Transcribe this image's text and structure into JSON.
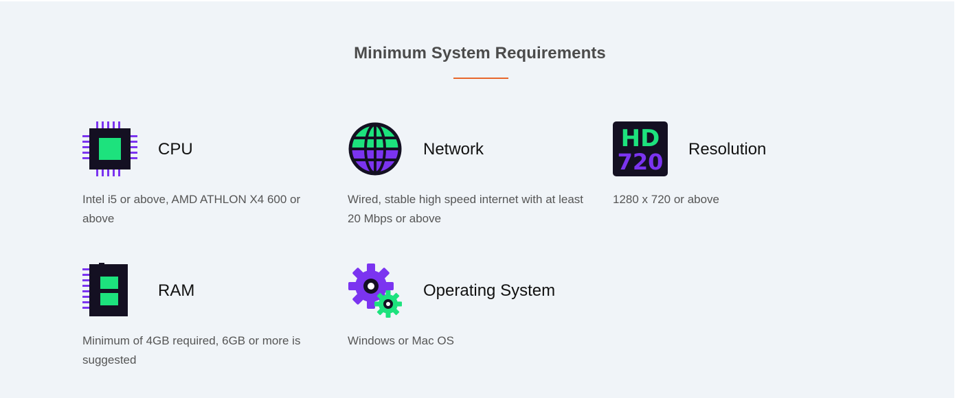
{
  "section": {
    "title": "Minimum System Requirements"
  },
  "colors": {
    "background": "#f0f4f8",
    "accent_underline": "#e8662a",
    "icon_dark": "#141022",
    "icon_green": "#1de27d",
    "icon_purple": "#7b34f0"
  },
  "requirements": [
    {
      "icon": "cpu-chip-icon",
      "title": "CPU",
      "description": "Intel i5 or above, AMD ATHLON X4 600 or above"
    },
    {
      "icon": "globe-icon",
      "title": "Network",
      "description": "Wired, stable high speed internet with at least 20 Mbps or above"
    },
    {
      "icon": "hd-720-icon",
      "title": "Resolution",
      "description": "1280 x 720 or above",
      "icon_text_top": "HD",
      "icon_text_bottom": "720"
    },
    {
      "icon": "ram-stick-icon",
      "title": "RAM",
      "description": "Minimum of 4GB required, 6GB or more is suggested"
    },
    {
      "icon": "gears-icon",
      "title": "Operating System",
      "description": "Windows or Mac OS"
    }
  ]
}
